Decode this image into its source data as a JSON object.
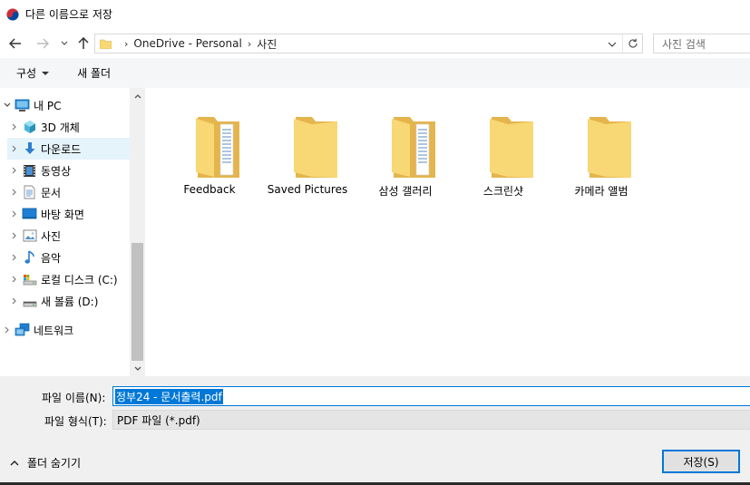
{
  "window": {
    "title": "다른 이름으로 저장"
  },
  "nav": {
    "breadcrumbs": [
      "OneDrive - Personal",
      "사진"
    ],
    "search_placeholder": "사진 검색"
  },
  "toolbar": {
    "organize_label": "구성",
    "new_folder_label": "새 폴더"
  },
  "tree": {
    "items": [
      {
        "label": "내 PC",
        "icon": "pc-icon",
        "expanded": true
      },
      {
        "label": "3D 개체",
        "icon": "3d-objects-icon"
      },
      {
        "label": "다운로드",
        "icon": "download-icon",
        "selected": true
      },
      {
        "label": "동영상",
        "icon": "video-icon"
      },
      {
        "label": "문서",
        "icon": "document-icon"
      },
      {
        "label": "바탕 화면",
        "icon": "desktop-icon"
      },
      {
        "label": "사진",
        "icon": "pictures-icon"
      },
      {
        "label": "음악",
        "icon": "music-icon"
      },
      {
        "label": "로컬 디스크 (C:)",
        "icon": "local-disk-icon"
      },
      {
        "label": "새 볼륨 (D:)",
        "icon": "drive-icon"
      },
      {
        "label": "네트워크",
        "icon": "network-icon"
      }
    ]
  },
  "folders": [
    {
      "name": "Feedback",
      "has_documents": true
    },
    {
      "name": "Saved Pictures",
      "has_documents": false
    },
    {
      "name": "삼성 갤러리",
      "has_documents": true
    },
    {
      "name": "스크린샷",
      "has_documents": false
    },
    {
      "name": "카메라 앨범",
      "has_documents": false
    }
  ],
  "form": {
    "filename_label": "파일 이름(N):",
    "filename_value": "정부24 - 문서출력.pdf",
    "filetype_label": "파일 형식(T):",
    "filetype_value": "PDF 파일 (*.pdf)",
    "hide_folders_label": "폴더 숨기기",
    "save_label": "저장(S)"
  },
  "colors": {
    "accent": "#0078d7",
    "folder": "#f8d775",
    "selection": "#e5f3fb"
  }
}
